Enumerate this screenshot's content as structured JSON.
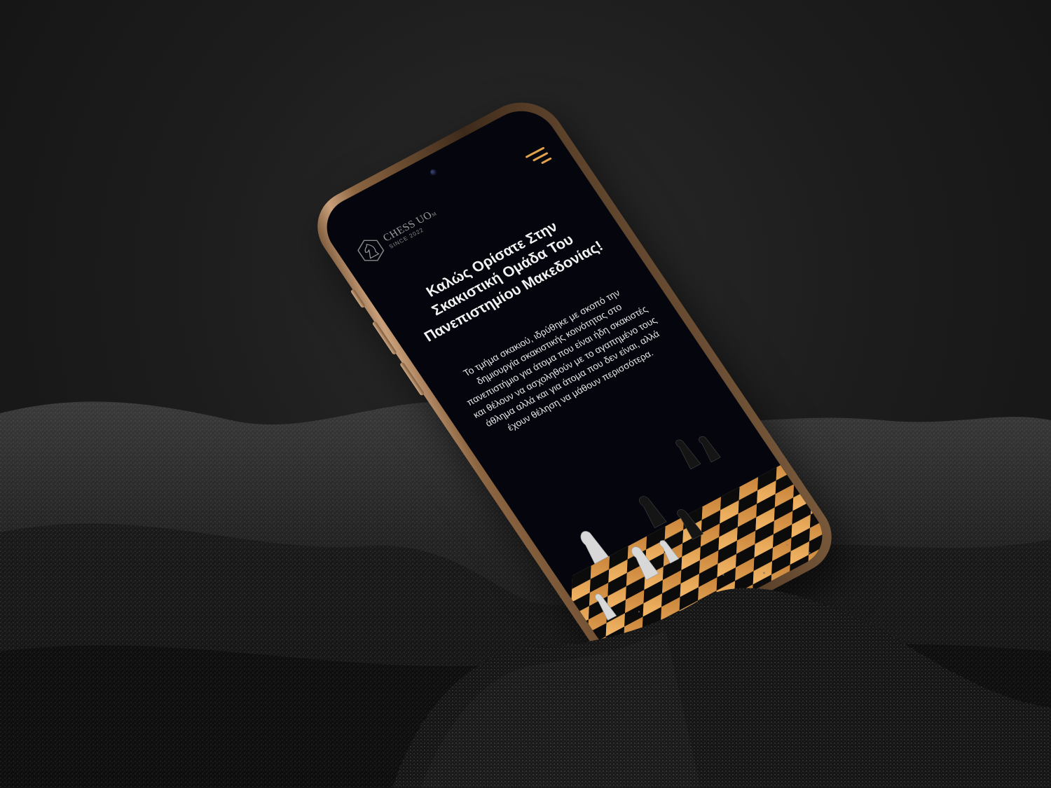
{
  "header": {
    "logo_name": "CHESS UO",
    "logo_suffix": "M",
    "logo_tagline": "SINCE 2022",
    "menu_icon": "hamburger-menu-icon"
  },
  "hero": {
    "title": "Καλώς Ορίσατε Στην Σκακιστική Ομάδα Του Πανεπιστημίου Μακεδονίας!",
    "description": "Το τμήμα σκακιού, ιδρύθηκε με σκοπό την δημιουργία σκακιστικής κοινότητας στο πανεπιστήμιο για άτομα που είναι ήδη σκακιστές και θέλουν να ασχοληθούν με το αγαπημένο τους άθλημα αλλά και για άτομα που δεν είναι, αλλά έχουν θέληση να μάθουν περισσότερα."
  },
  "illustration": {
    "subject": "chess-board-with-pieces",
    "board_light": "#e9a95a",
    "board_dark": "#0b0b0b"
  },
  "colors": {
    "accent": "#e0a24a",
    "screen_background": "#05060d",
    "text": "#f2f2f2",
    "phone_frame": "#8c6541"
  }
}
